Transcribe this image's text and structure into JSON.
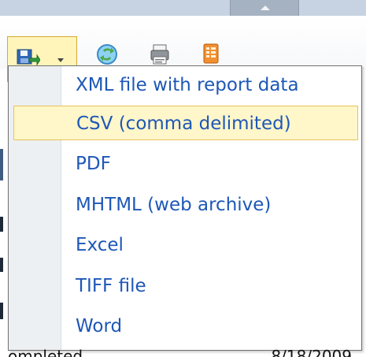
{
  "toolbar": {
    "export_icon": "save-export-icon",
    "refresh_icon": "refresh-icon",
    "print_icon": "printer-icon",
    "layout_icon": "document-map-icon"
  },
  "menu": {
    "items": [
      {
        "label": "XML file with report data"
      },
      {
        "label": "CSV (comma delimited)",
        "highlighted": true
      },
      {
        "label": "PDF"
      },
      {
        "label": "MHTML (web archive)"
      },
      {
        "label": "Excel"
      },
      {
        "label": "TIFF file"
      },
      {
        "label": "Word"
      }
    ]
  },
  "background": {
    "left_text": "ompleted",
    "right_text": "8/18/2009"
  },
  "colors": {
    "menu_text": "#1d57b7",
    "highlight_fill": "#fff6c9",
    "highlight_border": "#e8c35a",
    "toolbar_active": "#fff5ba"
  }
}
